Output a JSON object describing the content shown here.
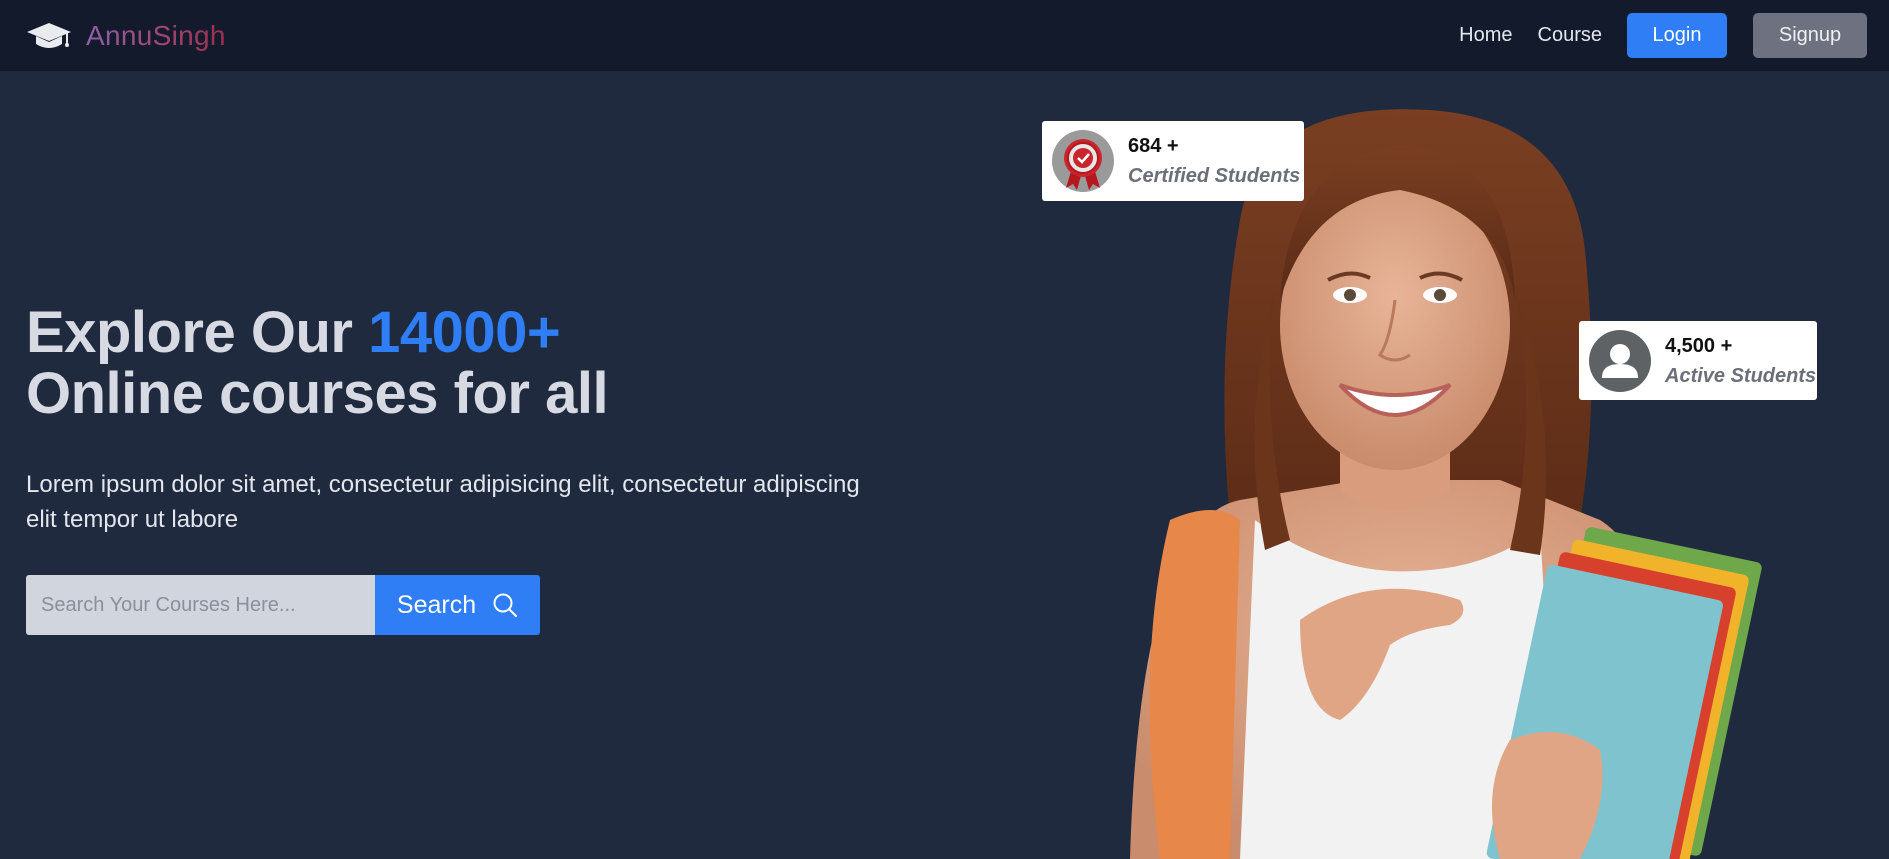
{
  "brand": {
    "name": "AnnuSingh",
    "icon": "graduation-cap-icon"
  },
  "nav": {
    "links": [
      "Home",
      "Course"
    ],
    "login_label": "Login",
    "signup_label": "Signup"
  },
  "hero": {
    "title_prefix": "Explore Our ",
    "title_highlight": "14000+",
    "title_line2": "Online courses for all",
    "description": "Lorem ipsum dolor sit amet, consectetur adipisicing elit, consectetur adipiscing elit tempor ut labore"
  },
  "search": {
    "placeholder": "Search Your Courses Here...",
    "button_label": "Search",
    "button_icon": "search-icon"
  },
  "stats": {
    "certified": {
      "count": "684 +",
      "label": "Certified Students",
      "icon": "certificate-badge-icon"
    },
    "active": {
      "count": "4,500 +",
      "label": "Active Students",
      "icon": "user-avatar-icon"
    }
  },
  "colors": {
    "background": "#1f2a3e",
    "navbar": "#121a2b",
    "accent": "#2f7ef5",
    "signup": "#6e7280",
    "brand_gradient_start": "#8f5fa8",
    "brand_gradient_end": "#9d2e4f"
  }
}
